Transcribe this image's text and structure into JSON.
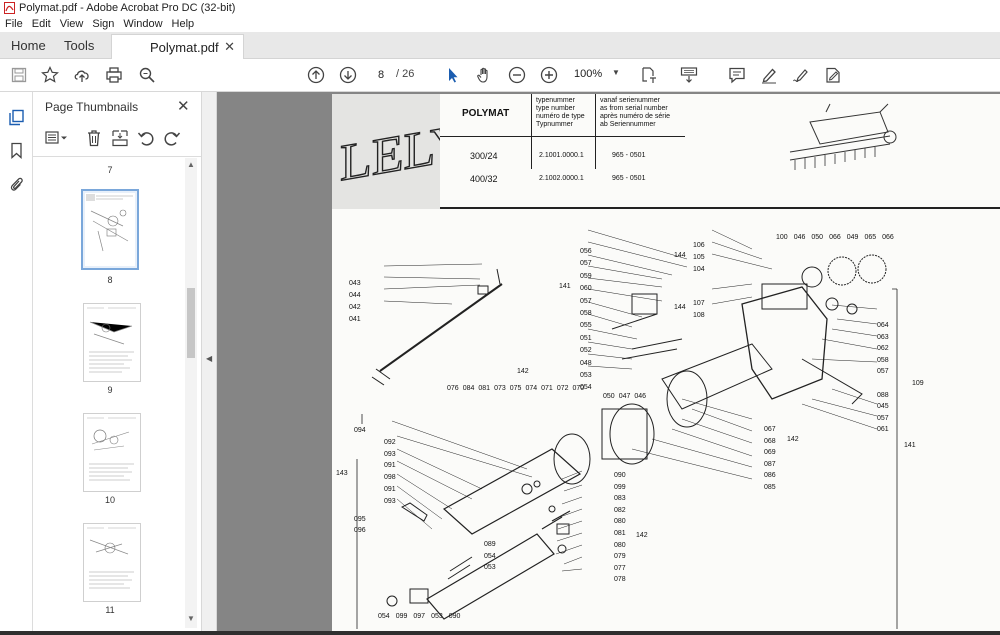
{
  "window": {
    "title": "Polymat.pdf - Adobe Acrobat Pro DC (32-bit)"
  },
  "menu": [
    "File",
    "Edit",
    "View",
    "Sign",
    "Window",
    "Help"
  ],
  "tabs": {
    "home": "Home",
    "tools": "Tools",
    "document": "Polymat.pdf"
  },
  "toolbar": {
    "current_page": "8",
    "total_pages": "/ 26",
    "zoom": "100%"
  },
  "thumbnails_panel": {
    "title": "Page Thumbnails",
    "pages": [
      {
        "label": "7"
      },
      {
        "label": "8",
        "selected": true
      },
      {
        "label": "9"
      },
      {
        "label": "10"
      },
      {
        "label": "11"
      }
    ]
  },
  "document": {
    "brand": "LELY",
    "header": {
      "model_name": "POLYMAT",
      "col_type": [
        "typenummer",
        "type number",
        "numéro de type",
        "Typnummer"
      ],
      "col_serial": [
        "vanaf serienummer",
        "as from serial number",
        "après numéro de série",
        "ab Seriennummer"
      ],
      "rows": [
        {
          "model": "300/24",
          "type": "2.1001.0000.1",
          "serial": "965 - 0501"
        },
        {
          "model": "400/32",
          "type": "2.1002.0000.1",
          "serial": "965 - 0501"
        }
      ]
    },
    "callouts": {
      "upper_mid": [
        "056",
        "057",
        "059",
        "060",
        "057",
        "058",
        "055",
        "051",
        "052",
        "048",
        "053",
        "054"
      ],
      "upper_mid_group": "141",
      "left_rod": [
        "043",
        "044",
        "042",
        "041"
      ],
      "top_right_a": [
        "106",
        "105",
        "104"
      ],
      "top_right_a_group": "144",
      "top_right_b": [
        "107",
        "108"
      ],
      "top_right_b_group": "144",
      "top_row": [
        "100",
        "046",
        "050",
        "066",
        "049",
        "065",
        "066"
      ],
      "right_col": [
        "064",
        "063",
        "062",
        "058",
        "057",
        "109",
        "088",
        "045",
        "057",
        "061"
      ],
      "right_group": "141",
      "mid_row_group": "142",
      "mid_row": [
        "076",
        "084",
        "081",
        "073",
        "075",
        "074",
        "071",
        "072",
        "070"
      ],
      "mid_row_b": [
        "050",
        "047",
        "046"
      ],
      "center_right": [
        "067",
        "068",
        "069",
        "087",
        "086",
        "085"
      ],
      "center_right_group": "142",
      "left_col": [
        "094",
        "092",
        "093",
        "091",
        "098",
        "091",
        "093",
        "095",
        "096"
      ],
      "left_group": "143",
      "center_col": [
        "090",
        "099",
        "083",
        "082",
        "080",
        "081",
        "080",
        "079",
        "077",
        "078"
      ],
      "center_group": "142",
      "lower_mid": [
        "089",
        "054",
        "053"
      ],
      "bottom_row": [
        "054",
        "099",
        "097",
        "053",
        "090"
      ]
    }
  }
}
